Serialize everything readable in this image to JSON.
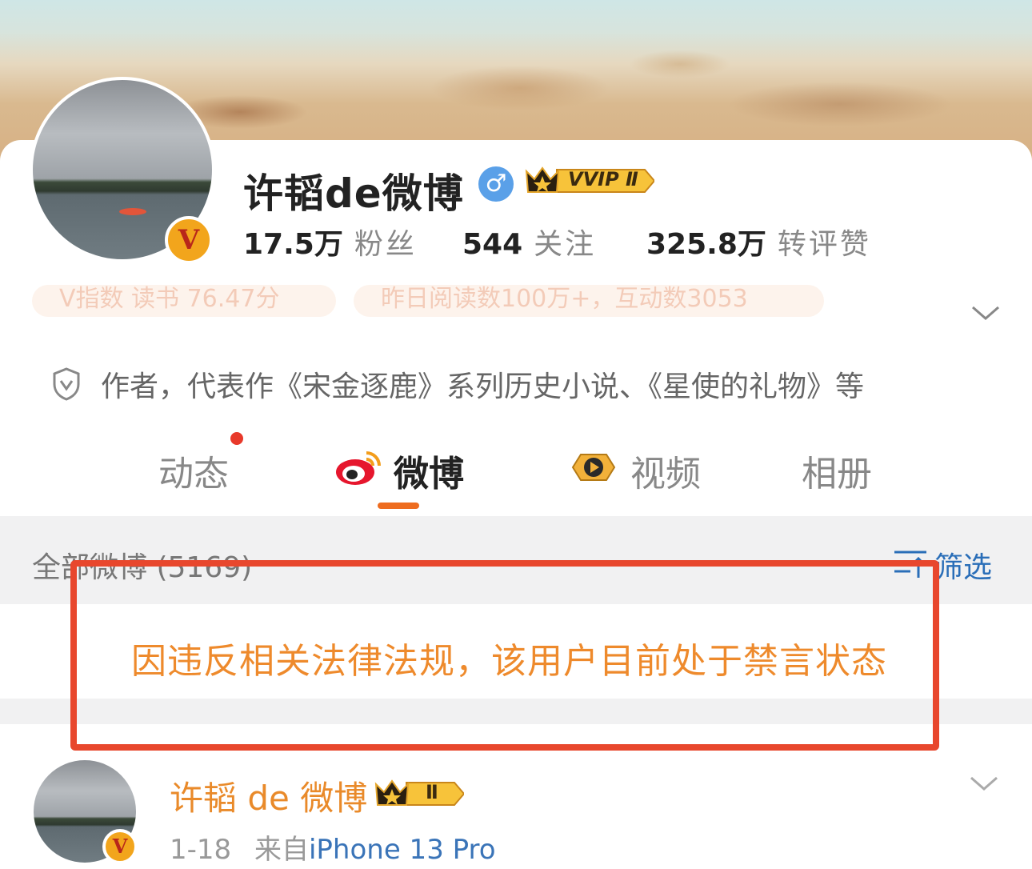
{
  "profile": {
    "name": "许韬de微博",
    "gender_symbol": "♂",
    "vip_label": "VVIP Ⅱ",
    "verified_letter": "V",
    "stats": [
      {
        "value": "17.5万",
        "label": "粉丝"
      },
      {
        "value": "544",
        "label": "关注"
      },
      {
        "value": "325.8万",
        "label": "转评赞"
      }
    ],
    "faded_tags": [
      "V指数 读书 76.47分",
      "昨日阅读数100万+，互动数3053"
    ],
    "intro": "作者，代表作《宋金逐鹿》系列历史小说、《星使的礼物》等"
  },
  "tabs": [
    {
      "label": "动态",
      "icon": ""
    },
    {
      "label": "微博",
      "icon": "weibo-logo-icon"
    },
    {
      "label": "视频",
      "icon": "video-badge-icon"
    },
    {
      "label": "相册",
      "icon": ""
    }
  ],
  "feed": {
    "all_label": "全部微博 (5169)",
    "filter_label": "筛选",
    "notice": "因违反相关法律法规，该用户目前处于禁言状态"
  },
  "post": {
    "author": "许韬 de 微博",
    "badge": "Ⅱ",
    "date": "1-18",
    "from_label": "来自",
    "source": "iPhone 13 Pro"
  },
  "colors": {
    "accent": "#ee6c1f",
    "notice": "#ee8a2c",
    "highlight_box": "#e8472d",
    "link": "#3a74b8"
  }
}
